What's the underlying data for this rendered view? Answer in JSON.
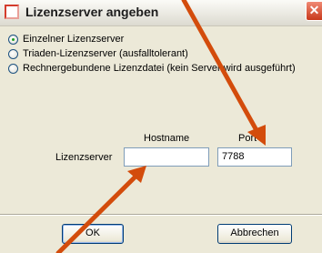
{
  "dialog": {
    "title": "Lizenzserver angeben",
    "close_glyph": "✕"
  },
  "options": [
    {
      "label": "Einzelner Lizenzserver",
      "selected": true
    },
    {
      "label": "Triaden-Lizenzserver (ausfalltolerant)",
      "selected": false
    },
    {
      "label": "Rechnergebundene Lizenzdatei (kein Server wird ausgeführt)",
      "selected": false
    }
  ],
  "form": {
    "hostname_header": "Hostname",
    "port_header": "Port",
    "row_label": "Lizenzserver",
    "hostname_value": "",
    "port_value": "7788"
  },
  "buttons": {
    "ok": "OK",
    "cancel": "Abbrechen"
  },
  "colors": {
    "annotation_arrow": "#d34c0c",
    "close_button": "#c8391c"
  },
  "icons": [
    "license-icon",
    "close-icon"
  ]
}
